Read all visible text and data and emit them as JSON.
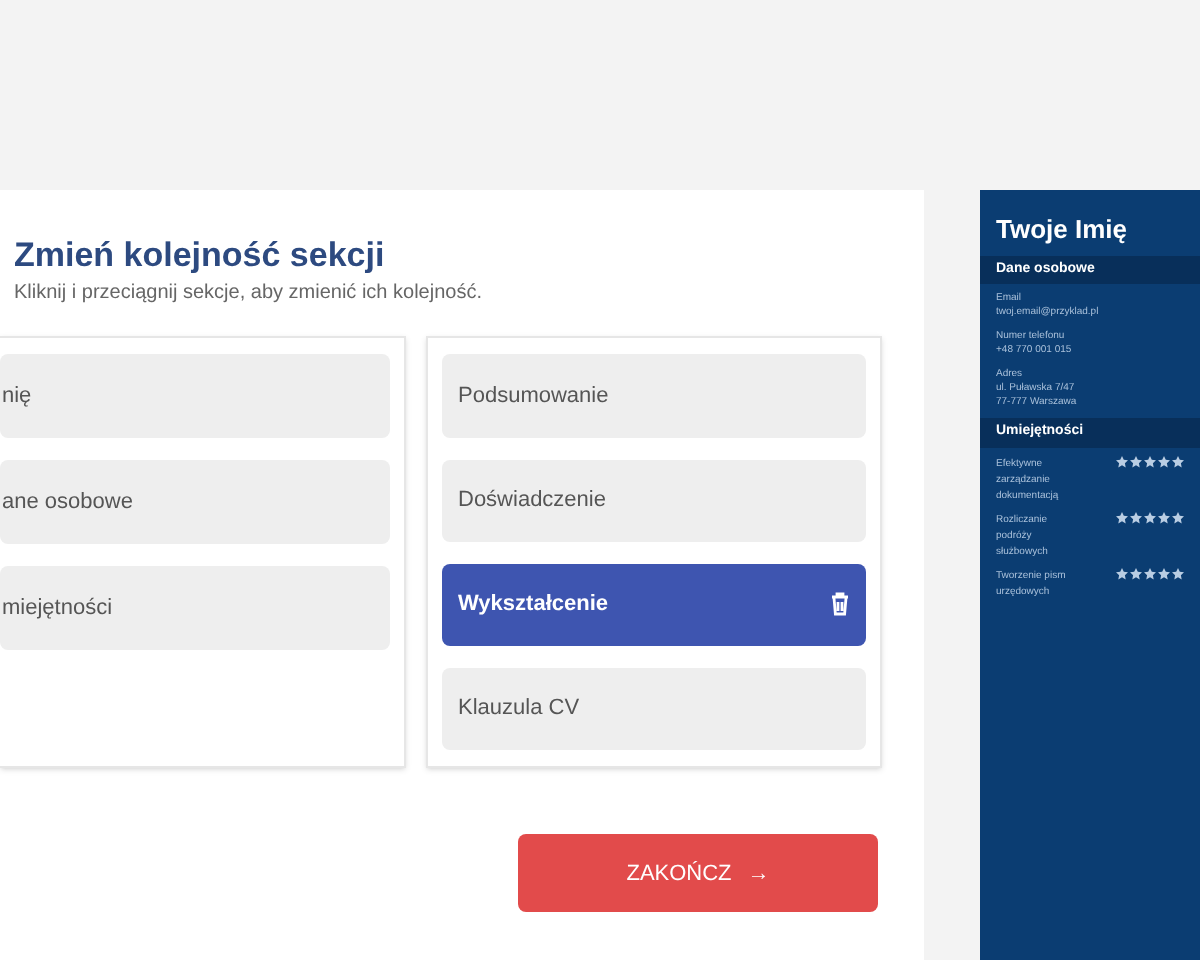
{
  "dialog": {
    "title": "Zmień kolejność sekcji",
    "subtitle": "Kliknij i przeciągnij sekcje, aby zmienić ich kolejność."
  },
  "columns": [
    {
      "sections": [
        {
          "label": "nię",
          "selected": false
        },
        {
          "label": "ane osobowe",
          "selected": false
        },
        {
          "label": "miejętności",
          "selected": false
        }
      ]
    },
    {
      "sections": [
        {
          "label": "Podsumowanie",
          "selected": false
        },
        {
          "label": "Doświadczenie",
          "selected": false
        },
        {
          "label": "Wykształcenie",
          "selected": true
        },
        {
          "label": "Klauzula CV",
          "selected": false
        }
      ]
    }
  ],
  "finish_button": {
    "label": "ZAKOŃCZ",
    "arrow": "→"
  },
  "preview": {
    "name": "Twoje Imię",
    "personal_heading": "Dane osobowe",
    "fields": [
      {
        "label": "Email",
        "lines": [
          "twoj.email@przyklad.pl"
        ]
      },
      {
        "label": "Numer telefonu",
        "lines": [
          "+48 770 001 015"
        ]
      },
      {
        "label": "Adres",
        "lines": [
          "ul. Puławska 7/47",
          "77-777 Warszawa"
        ]
      }
    ],
    "skills_heading": "Umiejętności",
    "skills": [
      {
        "name": "Efektywne zarządzanie dokumentacją",
        "stars": 5
      },
      {
        "name": "Rozliczanie podróży służbowych",
        "stars": 5
      },
      {
        "name": "Tworzenie pism urzędowych",
        "stars": 5
      }
    ]
  }
}
